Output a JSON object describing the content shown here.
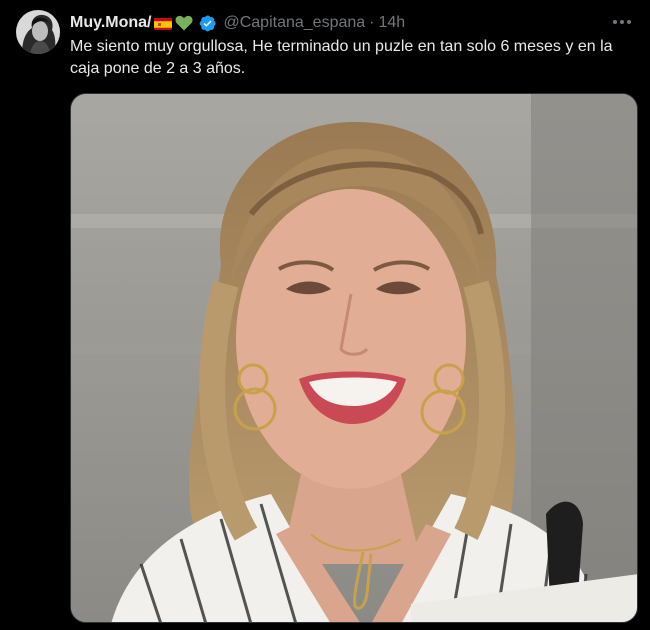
{
  "author": {
    "display_name": "Muy.Mona/",
    "handle": "@Capitana_espana",
    "separator": "·",
    "timestamp": "14h",
    "verified": true,
    "name_emojis": [
      "spain-flag-icon",
      "green-heart-icon"
    ]
  },
  "tweet": {
    "text": "Me siento muy orgullosa, He terminado un puzle en tan solo 6 meses y en la caja pone de 2 a 3 años."
  },
  "media": {
    "type": "photo"
  },
  "colors": {
    "background": "#000000",
    "text_primary": "#e7e9ea",
    "text_secondary": "#71767b",
    "verified_blue": "#1d9bf0",
    "heart_green": "#78b159"
  },
  "icons": {
    "more": "more-horizontal-icon",
    "verified": "verified-badge-icon"
  }
}
